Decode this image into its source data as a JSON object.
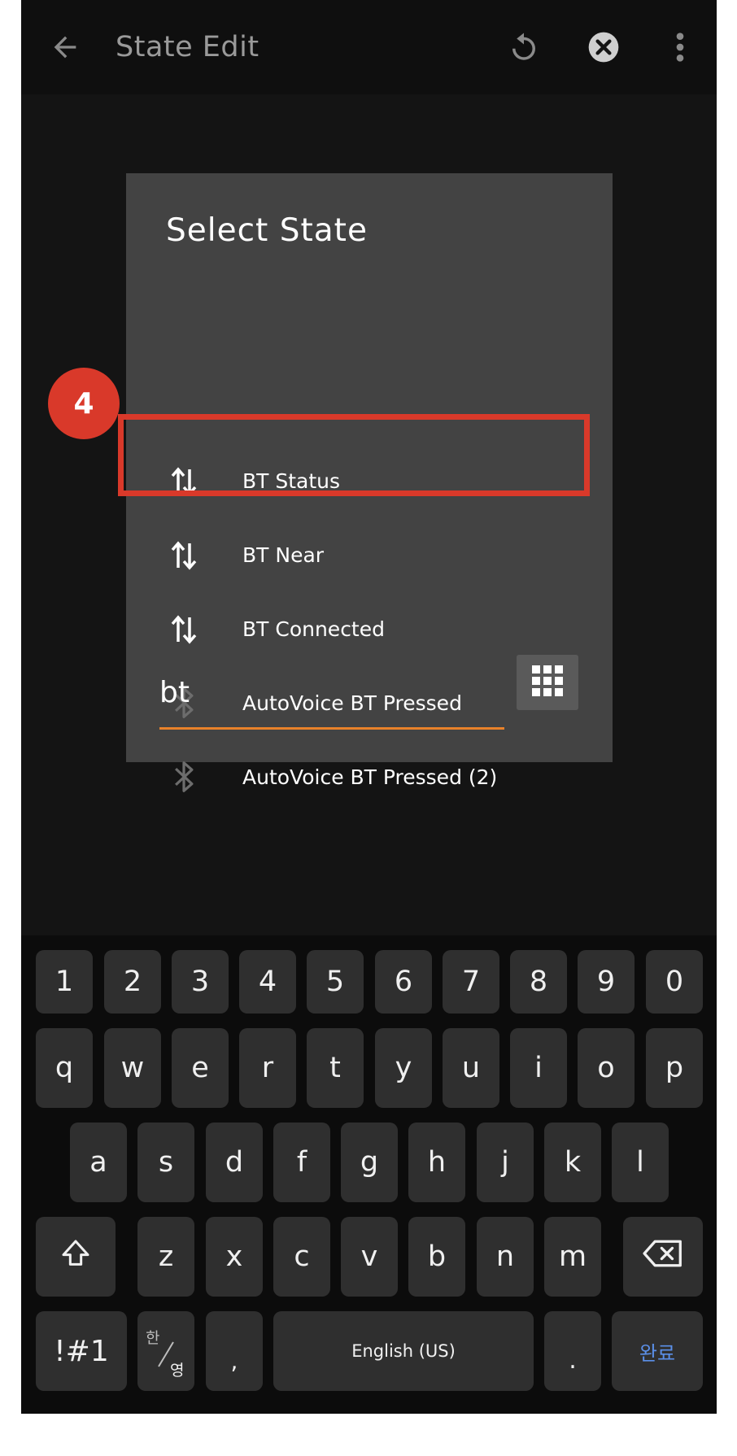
{
  "app_bar": {
    "title": "State Edit",
    "icons": [
      "back-arrow-icon",
      "undo-icon",
      "close-circle-icon",
      "more-vert-icon"
    ]
  },
  "dialog": {
    "title": "Select State",
    "items": [
      {
        "label": "BT Status",
        "icon": "up-down-arrows-icon"
      },
      {
        "label": "BT Near",
        "icon": "up-down-arrows-icon"
      },
      {
        "label": "BT Connected",
        "icon": "up-down-arrows-icon"
      },
      {
        "label": "AutoVoice BT Pressed",
        "icon": "bluetooth-icon"
      },
      {
        "label": "AutoVoice BT Pressed (2)",
        "icon": "bluetooth-icon"
      }
    ],
    "search_value": "bt",
    "grid_button_icon": "grid-icon",
    "highlighted_item": "BT Connected",
    "step_badge": "4"
  },
  "keyboard": {
    "row1": [
      "1",
      "2",
      "3",
      "4",
      "5",
      "6",
      "7",
      "8",
      "9",
      "0"
    ],
    "row2": [
      "q",
      "w",
      "e",
      "r",
      "t",
      "y",
      "u",
      "i",
      "o",
      "p"
    ],
    "row3": [
      "a",
      "s",
      "d",
      "f",
      "g",
      "h",
      "j",
      "k",
      "l"
    ],
    "row4": [
      "z",
      "x",
      "c",
      "v",
      "b",
      "n",
      "m"
    ],
    "symbols_key": "!#1",
    "lang_key_top": "한",
    "lang_key_bottom": "영",
    "comma_key": ",",
    "space_key": "English (US)",
    "period_key": ".",
    "done_key": "완료"
  },
  "colors": {
    "highlight": "#d9392a",
    "search_underline": "#e8822a",
    "done_key_text": "#5b8fe8"
  }
}
